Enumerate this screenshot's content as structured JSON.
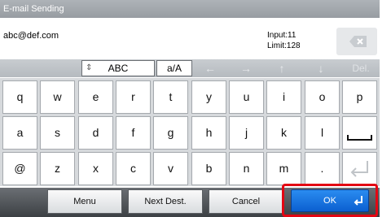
{
  "title": "E-mail Sending",
  "input": {
    "value": "abc@def.com",
    "count_label": "Input:11",
    "limit_label": "Limit:128"
  },
  "mode": {
    "charset_label": "ABC",
    "case_label": "a/A",
    "delete_label": "Del."
  },
  "keys": {
    "row1": [
      "q",
      "w",
      "e",
      "r",
      "t",
      "y",
      "u",
      "i",
      "o",
      "p"
    ],
    "row2": [
      "a",
      "s",
      "d",
      "f",
      "g",
      "h",
      "j",
      "k",
      "l"
    ],
    "row3": [
      "@",
      "z",
      "x",
      "c",
      "v",
      "b",
      "n",
      "m",
      "."
    ]
  },
  "buttons": {
    "menu": "Menu",
    "next_dest": "Next Dest.",
    "cancel": "Cancel",
    "ok": "OK"
  },
  "colors": {
    "ok_blue": "#1a73e8",
    "highlight_red": "#e30613"
  }
}
